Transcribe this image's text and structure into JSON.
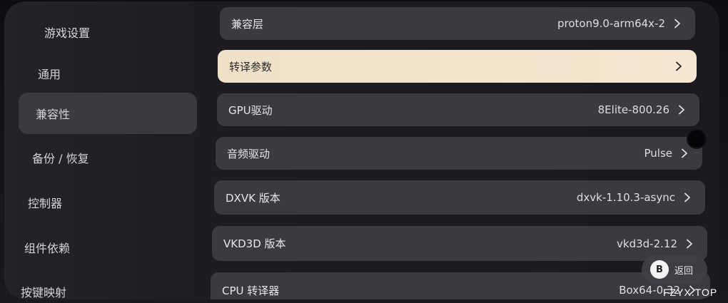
{
  "sidebar": {
    "title": "游戏设置",
    "items": [
      {
        "label": "通用"
      },
      {
        "label": "兼容性",
        "active": true
      },
      {
        "label": "备份 / 恢复"
      },
      {
        "label": "控制器"
      },
      {
        "label": "组件依赖"
      },
      {
        "label": "按键映射"
      }
    ]
  },
  "settings": [
    {
      "label": "兼容层",
      "value": "proton9.0-arm64x-2"
    },
    {
      "label": "转译参数",
      "value": ""
    },
    {
      "label": "GPU驱动",
      "value": "8Elite-800.26"
    },
    {
      "label": "音频驱动",
      "value": "Pulse"
    },
    {
      "label": "DXVK 版本",
      "value": "dxvk-1.10.3-async"
    },
    {
      "label": "VKD3D 版本",
      "value": "vkd3d-2.12"
    },
    {
      "label": "CPU 转译器",
      "value": "Box64-0.32"
    }
  ],
  "back_button": {
    "key": "B",
    "label": "返回"
  },
  "watermark": "FZYX.TOP",
  "icons": {
    "row_chevron": "chevron-right-icon"
  },
  "colors": {
    "highlight": "#f1e2cc",
    "row_bg": "#3a3a40",
    "screen_bg": "#1c1c21"
  }
}
